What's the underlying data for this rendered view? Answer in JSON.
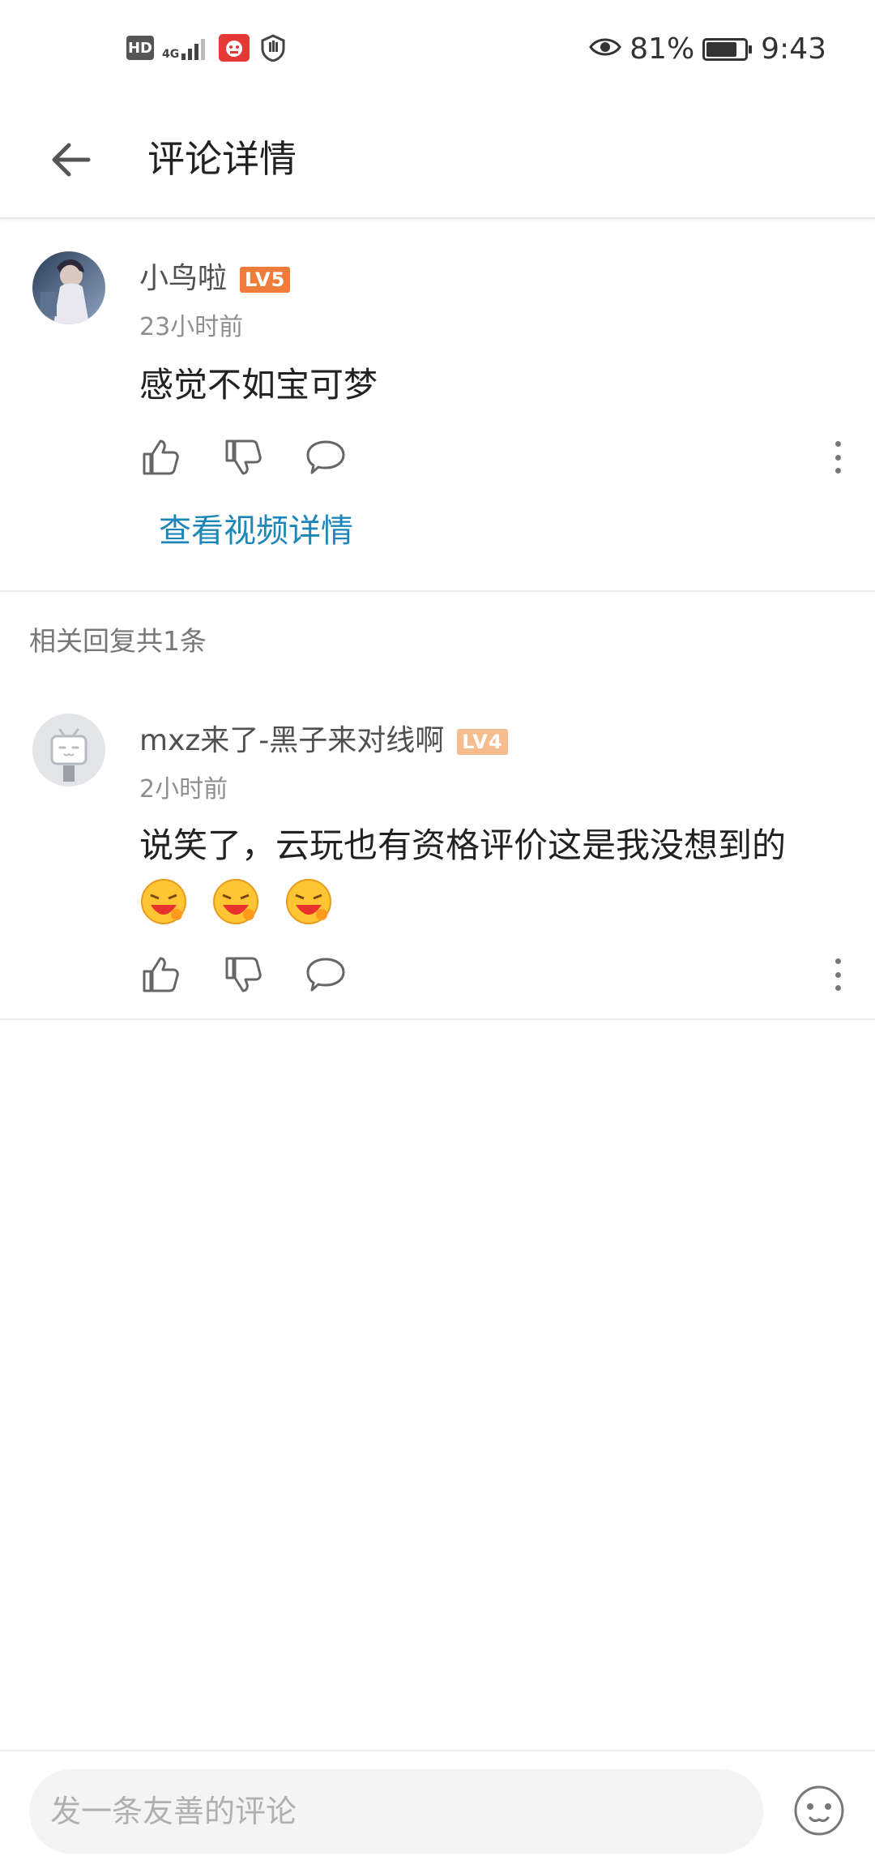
{
  "status_bar": {
    "hd_label": "HD",
    "network_label": "4G",
    "battery_percent": "81%",
    "battery_level": 0.81,
    "time": "9:43"
  },
  "header": {
    "title": "评论详情",
    "back_icon": "arrow-left-icon"
  },
  "main_comment": {
    "username": "小鸟啦",
    "level": "LV5",
    "level_color": "#f07c3c",
    "time": "23小时前",
    "content": "感觉不如宝可梦",
    "view_video_link": "查看视频详情"
  },
  "replies_section": {
    "label": "相关回复共1条"
  },
  "reply": {
    "username": "mxz来了-黑子来对线啊",
    "level": "LV4",
    "level_color": "#f6bc8e",
    "time": "2小时前",
    "content": "说笑了，云玩也有资格评价这是我没想到的",
    "emojis": [
      "laughing-emoji",
      "laughing-emoji",
      "laughing-emoji"
    ]
  },
  "bottom_bar": {
    "input_placeholder": "发一条友善的评论",
    "emoji_button_icon": "smiley-face-icon"
  },
  "colors": {
    "link": "#1c86b8",
    "secondary_text": "#8e8e8e"
  }
}
